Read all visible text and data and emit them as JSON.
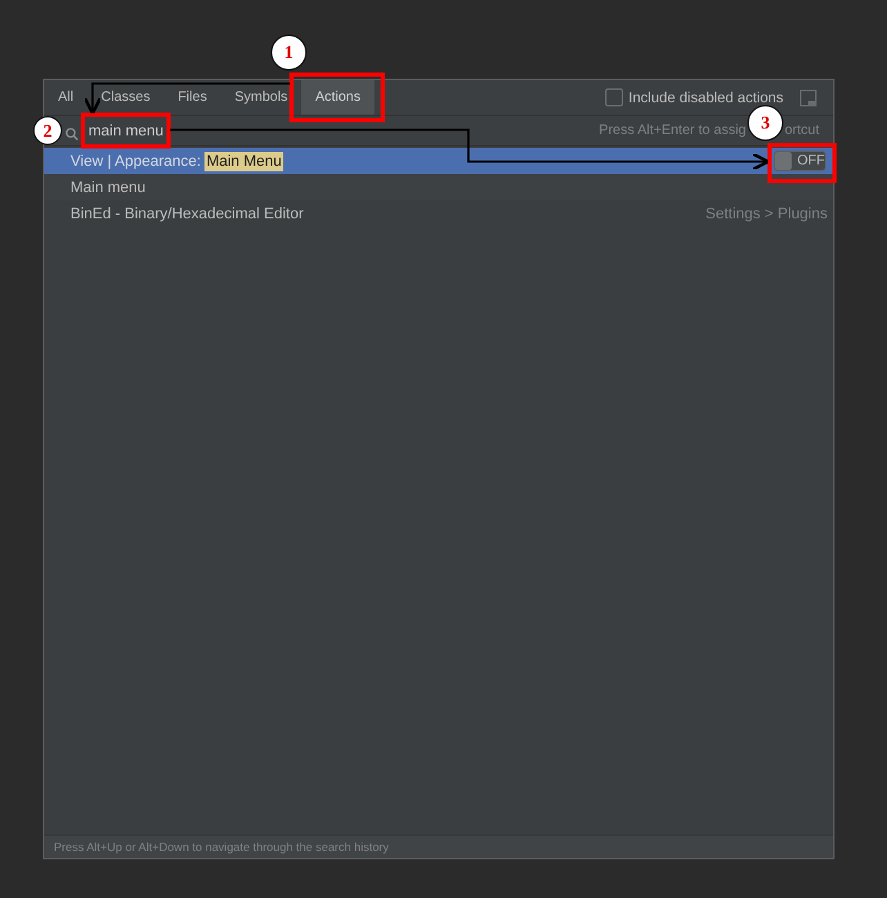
{
  "tabs": [
    {
      "label": "All",
      "selected": false
    },
    {
      "label": "Classes",
      "selected": false
    },
    {
      "label": "Files",
      "selected": false
    },
    {
      "label": "Symbols",
      "selected": false
    },
    {
      "label": "Actions",
      "selected": true
    }
  ],
  "include_disabled": {
    "label": "Include disabled actions",
    "checked": false
  },
  "search": {
    "value": "main menu"
  },
  "hint": [
    "Press Alt+Enter to assig",
    "ortcut"
  ],
  "results": [
    {
      "parts": [
        {
          "text": "View | Appearance: ",
          "highlighted": false
        },
        {
          "text": "Main Menu",
          "highlighted": true
        }
      ],
      "selected": true,
      "toggle": {
        "label": "OFF",
        "on": false
      }
    },
    {
      "parts": [
        {
          "text": "Main menu",
          "highlighted": false
        }
      ],
      "selected": false
    },
    {
      "parts": [
        {
          "text": "BinEd - Binary/Hexadecimal Editor",
          "highlighted": false
        }
      ],
      "selected": false,
      "location": "Settings > Plugins"
    }
  ],
  "status_bar": "Press Alt+Up or Alt+Down to navigate through the search history",
  "annotations": [
    {
      "number": "1"
    },
    {
      "number": "2"
    },
    {
      "number": "3"
    }
  ]
}
